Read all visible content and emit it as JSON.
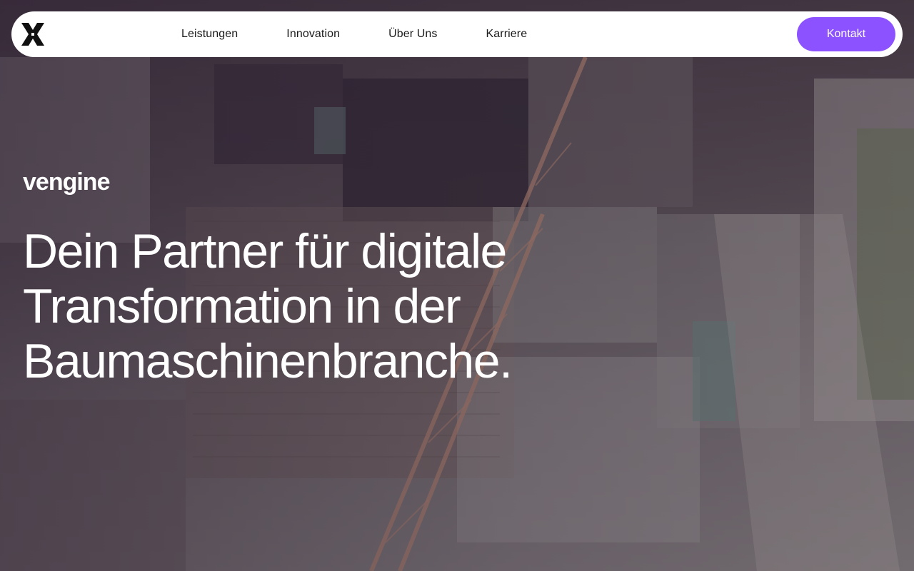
{
  "nav": {
    "logo_icon": "vengine-star-icon",
    "links": [
      "Leistungen",
      "Innovation",
      "Über Uns",
      "Karriere"
    ],
    "cta_label": "Kontakt"
  },
  "hero": {
    "brand": "vengine",
    "headline": "Dein Partner für digitale Transformation in der Baumaschinenbranche.",
    "background_image": "aerial-construction-site"
  },
  "colors": {
    "accent": "#8c52ff",
    "navbar_bg": "#ffffff",
    "text_on_hero": "#ffffff"
  }
}
